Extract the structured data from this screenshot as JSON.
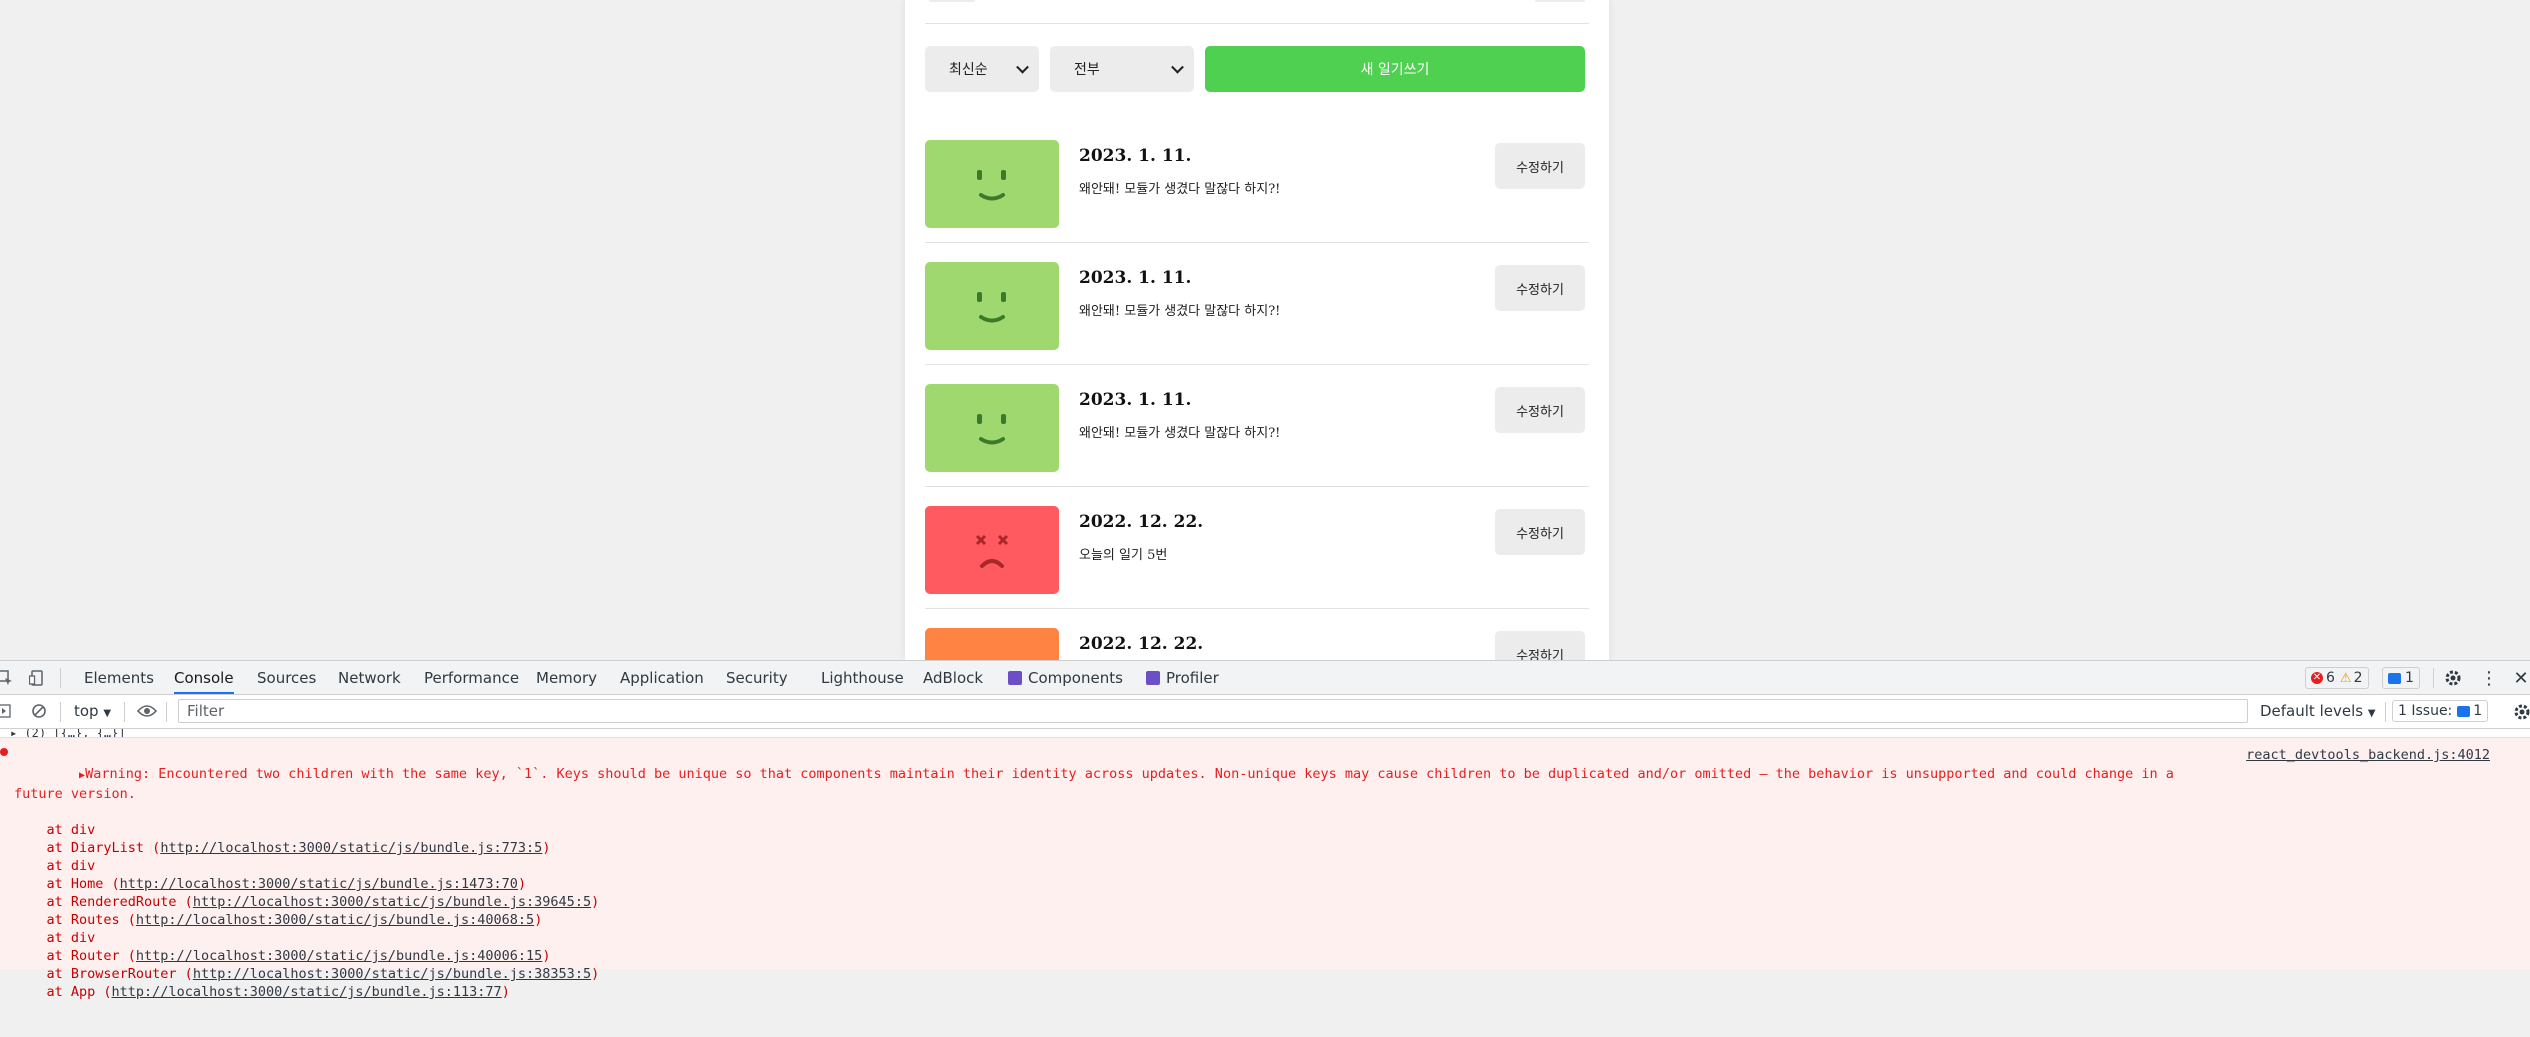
{
  "app": {
    "sort_select": "최신순",
    "filter_select": "전부",
    "new_button": "새 일기쓰기",
    "items": [
      {
        "date": "2023. 1. 11.",
        "content": "왜안돼! 모듈가 생겼다 말잖다 하지?!",
        "edit": "수정하기",
        "emotion_color": "#9fd86f",
        "emotion": "good-face-icon"
      },
      {
        "date": "2023. 1. 11.",
        "content": "왜안돼! 모듈가 생겼다 말잖다 하지?!",
        "edit": "수정하기",
        "emotion_color": "#9fd86f",
        "emotion": "good-face-icon"
      },
      {
        "date": "2023. 1. 11.",
        "content": "왜안돼! 모듈가 생겼다 말잖다 하지?!",
        "edit": "수정하기",
        "emotion_color": "#9fd86f",
        "emotion": "good-face-icon"
      },
      {
        "date": "2022. 12. 22.",
        "content": "오늘의 일기 5번",
        "edit": "수정하기",
        "emotion_color": "#ff5a5f",
        "emotion": "terrible-face-icon"
      },
      {
        "date": "2022. 12. 22.",
        "content": "",
        "edit": "수정하기",
        "emotion_color": "#ff8444",
        "emotion": "bad-face-icon"
      }
    ]
  },
  "devtools": {
    "tabs": [
      "Elements",
      "Console",
      "Sources",
      "Network",
      "Performance",
      "Memory",
      "Application",
      "Security",
      "Lighthouse",
      "AdBlock",
      "Components",
      "Profiler"
    ],
    "active_tab": "Console",
    "errors_count": "6",
    "warnings_count": "2",
    "messages_count": "1",
    "context": "top",
    "filter_placeholder": "Filter",
    "levels": "Default levels",
    "issues_label": "1 Issue:",
    "issues_count": "1",
    "warning_text": "Warning: Encountered two children with the same key, `1`. Keys should be unique so that components maintain their identity across updates. Non-unique keys may cause children to be duplicated and/or omitted — the behavior is unsupported and could change in a future version.",
    "warning_source": "react_devtools_backend.js:4012",
    "stack": [
      {
        "pre": "    at div",
        "link": "",
        "post": ""
      },
      {
        "pre": "    at DiaryList (",
        "link": "http://localhost:3000/static/js/bundle.js:773:5",
        "post": ")"
      },
      {
        "pre": "    at div",
        "link": "",
        "post": ""
      },
      {
        "pre": "    at Home (",
        "link": "http://localhost:3000/static/js/bundle.js:1473:70",
        "post": ")"
      },
      {
        "pre": "    at RenderedRoute (",
        "link": "http://localhost:3000/static/js/bundle.js:39645:5",
        "post": ")"
      },
      {
        "pre": "    at Routes (",
        "link": "http://localhost:3000/static/js/bundle.js:40068:5",
        "post": ")"
      },
      {
        "pre": "    at div",
        "link": "",
        "post": ""
      },
      {
        "pre": "    at Router (",
        "link": "http://localhost:3000/static/js/bundle.js:40006:15",
        "post": ")"
      },
      {
        "pre": "    at BrowserRouter (",
        "link": "http://localhost:3000/static/js/bundle.js:38353:5",
        "post": ")"
      },
      {
        "pre": "    at App (",
        "link": "http://localhost:3000/static/js/bundle.js:113:77",
        "post": ")"
      }
    ],
    "colors": {
      "error": "#e81e1e",
      "accent": "#1a73e8",
      "error_bg": "#fff0f0"
    }
  }
}
